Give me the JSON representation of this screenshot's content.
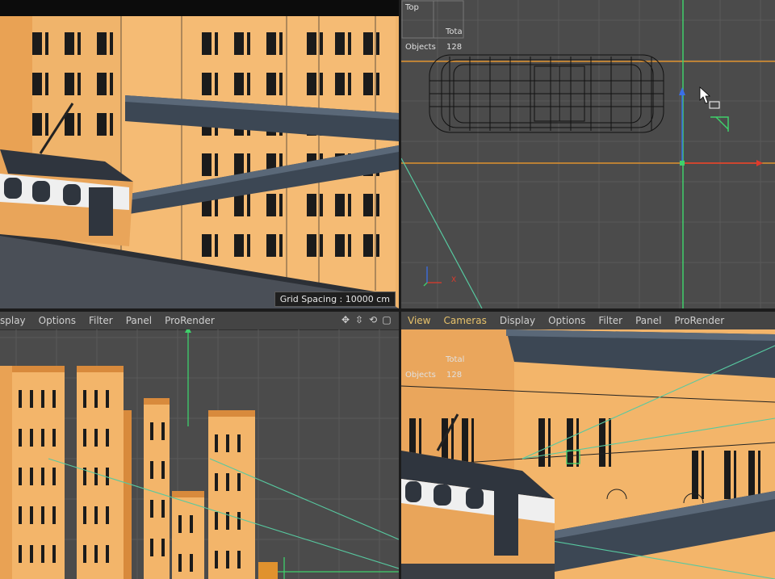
{
  "viewport_top_right": {
    "view_name": "Top",
    "hud_total_label": "Total",
    "hud_objects_label": "Objects",
    "hud_objects_value": "128"
  },
  "viewport_top_left": {
    "grid_spacing": "Grid Spacing : 10000 cm"
  },
  "viewport_bottom_left": {
    "menu": [
      "splay",
      "Options",
      "Filter",
      "Panel",
      "ProRender"
    ]
  },
  "viewport_bottom_right": {
    "menu": [
      "View",
      "Cameras",
      "Display",
      "Options",
      "Filter",
      "Panel",
      "ProRender"
    ],
    "hud_total_label": "Total",
    "hud_objects_label": "Objects",
    "hud_objects_value": "128"
  },
  "nav_icons": [
    "move-icon",
    "scale-icon",
    "rotate-icon",
    "maximize-icon"
  ],
  "colors": {
    "building": "#f3b56a",
    "building_dark": "#d88a3c",
    "window": "#1b1b1b",
    "viewport_bg": "#4b4b4b",
    "axis_green": "#3fd06b",
    "axis_red": "#e0392b",
    "axis_blue": "#3a6ee8",
    "wire_orange": "#e0922e",
    "menu_highlight": "#e7c26b"
  }
}
